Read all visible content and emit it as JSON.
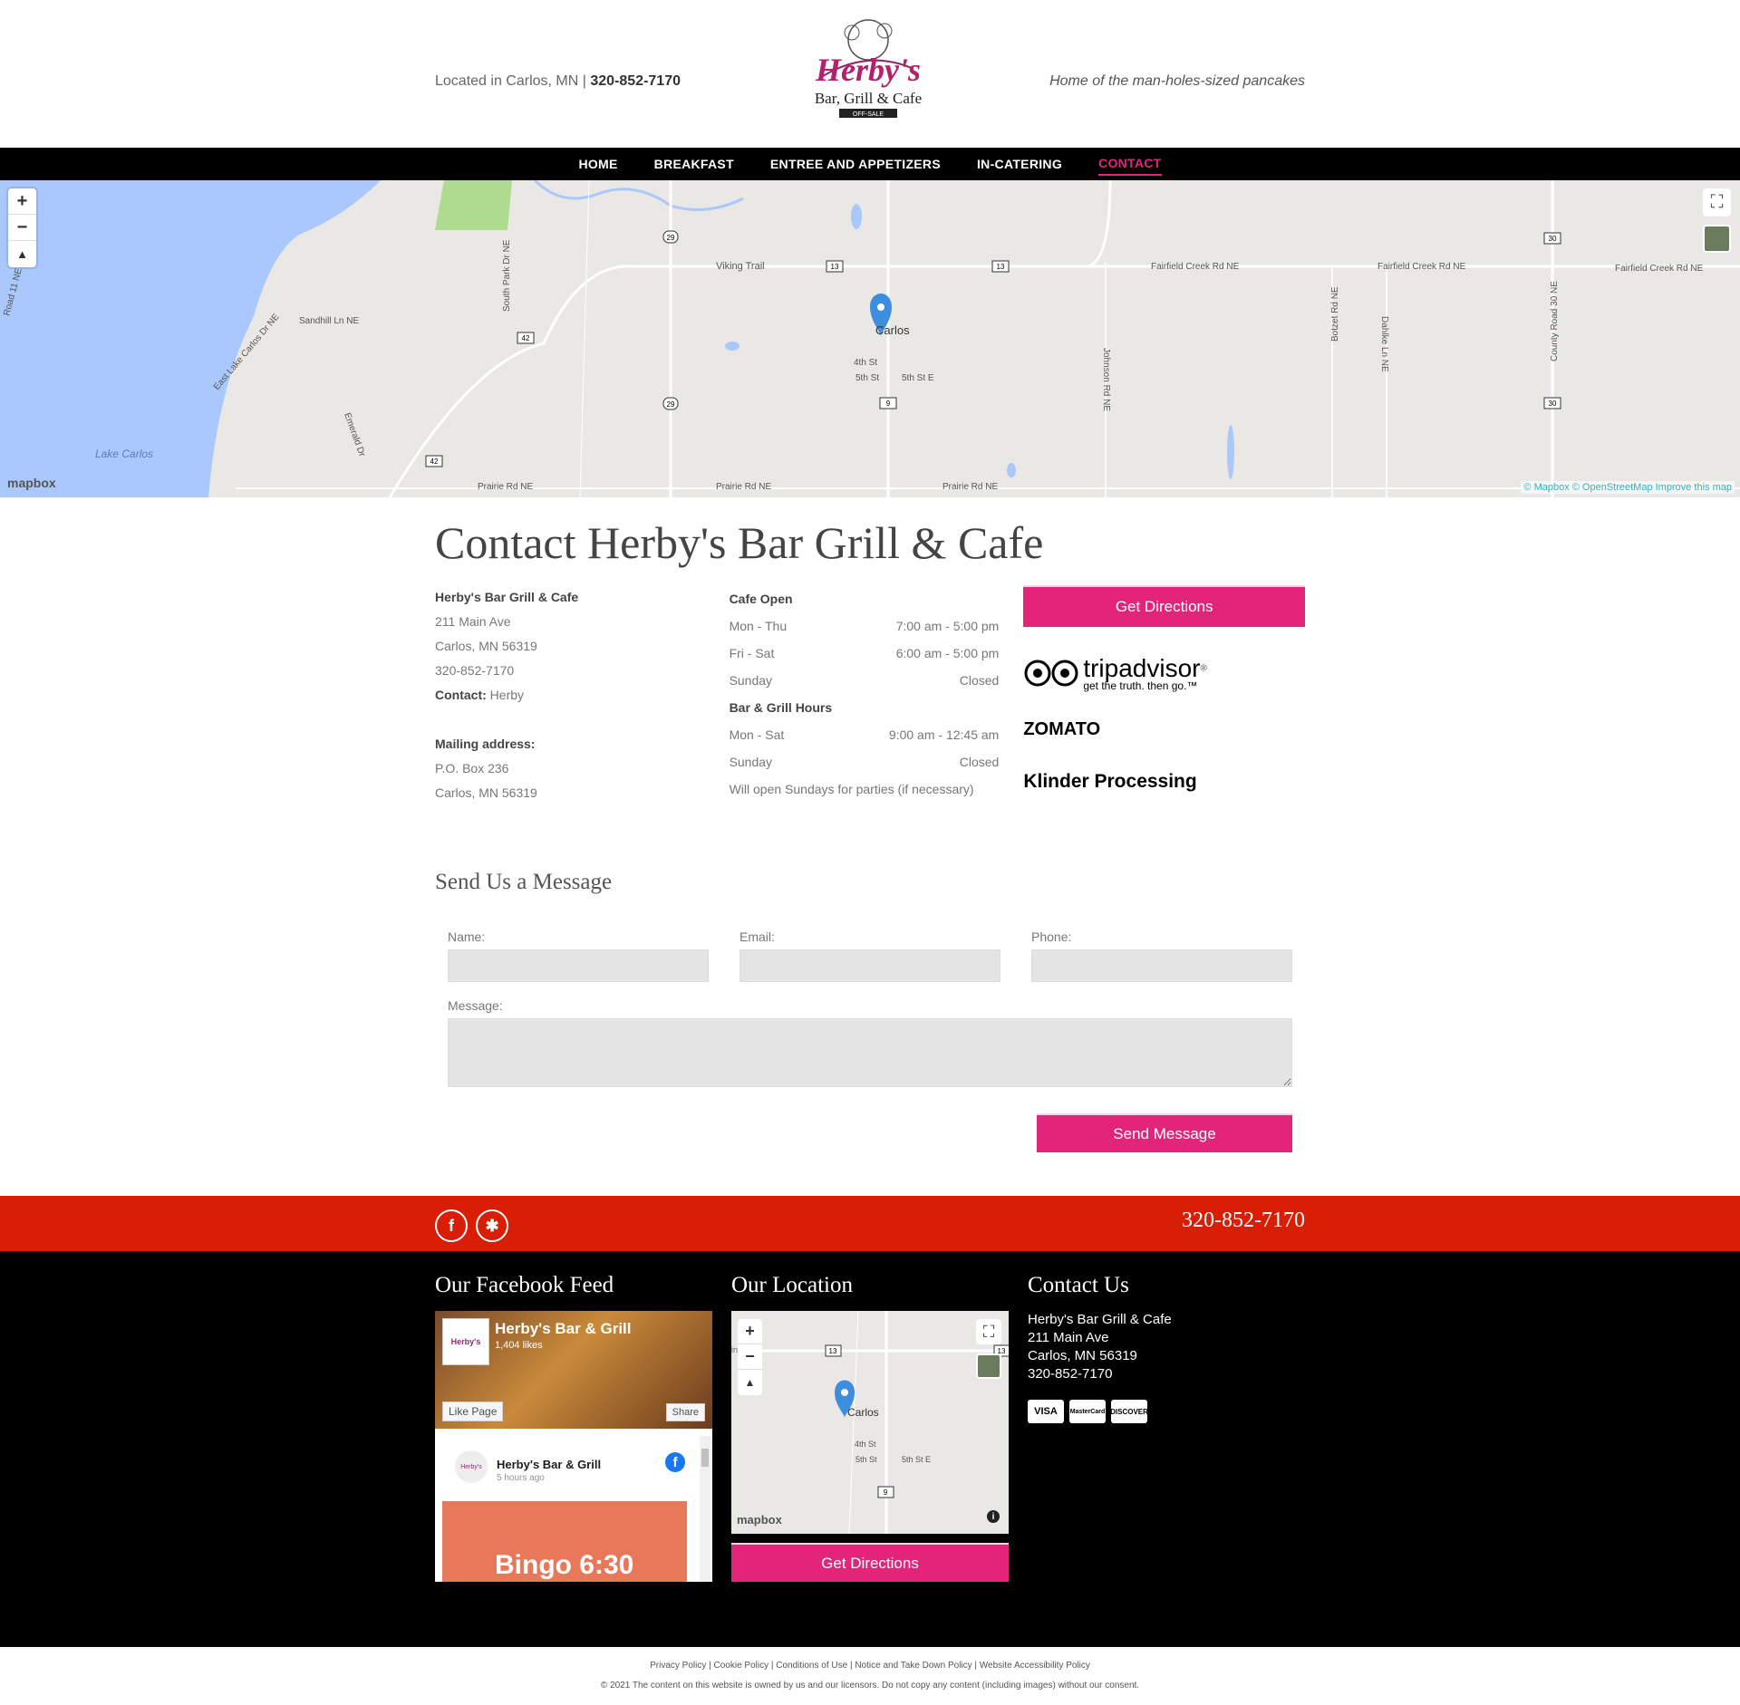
{
  "header": {
    "location_prefix": "Located in Carlos, MN |",
    "phone": "320-852-7170",
    "logo_main": "Herby's",
    "logo_sub": "Bar, Grill & Cafe",
    "logo_small": "OFF-SALE",
    "tagline": "Home of the man-holes-sized pancakes"
  },
  "nav": {
    "items": [
      "HOME",
      "BREAKFAST",
      "ENTREE AND APPETIZERS",
      "IN-CATERING",
      "CONTACT"
    ],
    "active": "CONTACT"
  },
  "map": {
    "zoom_in": "+",
    "zoom_out": "−",
    "compass": "▲",
    "fullscreen": "⛶",
    "logo": "mapbox",
    "attribution": "© Mapbox © OpenStreetMap  Improve this map",
    "labels": {
      "lake": "Lake Carlos",
      "viking": "Viking Trail",
      "fairfield1": "Fairfield Creek Rd NE",
      "fairfield2": "Fairfield Creek Rd NE",
      "fairfield3": "Fairfield Creek Rd NE",
      "sandhill": "Sandhill Ln NE",
      "southpark": "South Park Dr NE",
      "eastlake": "East Lake Carlos Dr NE",
      "emerald": "Emerald Dr",
      "road11": "Road 11 NE",
      "johnson": "Johnson Rd NE",
      "botzet": "Botzet Rd NE",
      "dahlke": "Dahlke Ln NE",
      "county30": "County Road 30 NE",
      "prairie1": "Prairie Rd NE",
      "prairie2": "Prairie Rd NE",
      "prairie3": "Prairie Rd NE",
      "carlos": "Carlos",
      "fourth": "4th St",
      "fifth": "5th St",
      "fifthe": "5th St E",
      "r29a": "29",
      "r29b": "29",
      "r13a": "13",
      "r13b": "13",
      "r42a": "42",
      "r42b": "42",
      "r9": "9",
      "r30a": "30",
      "r30b": "30"
    }
  },
  "contact": {
    "title": "Contact Herby's Bar Grill & Cafe",
    "business_name": "Herby's Bar Grill & Cafe",
    "address1": "211 Main Ave",
    "address2": "Carlos, MN 56319",
    "phone": "320-852-7170",
    "contact_label": "Contact:",
    "contact_name": "Herby",
    "mailing_label": "Mailing address:",
    "mailing1": "P.O. Box 236",
    "mailing2": "Carlos, MN 56319",
    "cafe_heading": "Cafe Open",
    "cafe_hours": [
      {
        "day": "Mon - Thu",
        "time": "7:00 am - 5:00 pm"
      },
      {
        "day": "Fri - Sat",
        "time": "6:00 am - 5:00 pm"
      },
      {
        "day": "Sunday",
        "time": "Closed"
      }
    ],
    "bar_heading": "Bar & Grill Hours",
    "bar_hours": [
      {
        "day": "Mon - Sat",
        "time": "9:00 am - 12:45 am"
      },
      {
        "day": "Sunday",
        "time": "Closed"
      }
    ],
    "note": "Will open Sundays for parties (if necessary)",
    "directions_button": "Get Directions",
    "tripadvisor": "tripadvisor",
    "tripadvisor_reg": "®",
    "tripadvisor_tag": "get the truth. then go.™",
    "zomato": "ZOMATO",
    "klinder": "Klinder Processing"
  },
  "message": {
    "title": "Send Us a Message",
    "name_label": "Name:",
    "email_label": "Email:",
    "phone_label": "Phone:",
    "message_label": "Message:",
    "send_button": "Send Message"
  },
  "redbar": {
    "facebook_glyph": "f",
    "yelp_glyph": "✱",
    "phone": "320-852-7170"
  },
  "footer": {
    "fb_title": "Our Facebook Feed",
    "fb_page_name": "Herby's Bar & Grill",
    "fb_likes": "1,404 likes",
    "fb_like_btn": "Like Page",
    "fb_share_btn": "Share",
    "fb_post_name": "Herby's Bar & Grill",
    "fb_post_time": "5 hours ago",
    "fb_post_text": "Bingo 6:30",
    "fb_avatar_text": "Herby's",
    "location_title": "Our Location",
    "mini_labels": {
      "carlos": "Carlos",
      "fourth": "4th St",
      "fifth": "5th St",
      "fifthe": "5th St E",
      "r13a": "13",
      "r13b": "13",
      "r9": "9",
      "edge": "in"
    },
    "location_button": "Get Directions",
    "mini_info": "i",
    "contact_title": "Contact Us",
    "contact_name": "Herby's Bar Grill & Cafe",
    "contact_addr1": "211 Main Ave",
    "contact_addr2": "Carlos, MN 56319",
    "contact_phone": "320-852-7170",
    "cards": [
      "VISA",
      "MasterCard",
      "DISCOVER"
    ]
  },
  "bottom": {
    "links": "Privacy Policy | Cookie Policy | Conditions of Use | Notice and Take Down Policy | Website Accessibility Policy",
    "copyright": "© 2021 The content on this website is owned by us and our licensors. Do not copy any content (including images) without our consent."
  },
  "colors": {
    "accent": "#e2247b",
    "red_bar": "#d91e05",
    "nav_bg": "#000000",
    "map_land": "#e9e8e4",
    "map_water": "#aac8fb"
  }
}
